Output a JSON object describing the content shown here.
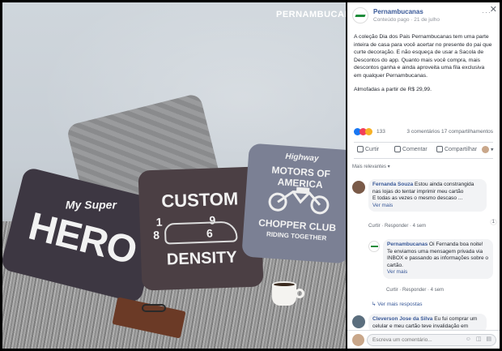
{
  "photo": {
    "watermark": "PERNAMBUCANAS",
    "pillows": {
      "hero_small": "My Super",
      "hero_big": "HERO",
      "custom_top": "CUSTOM",
      "custom_nums": "19 86",
      "custom_bottom": "DENSITY",
      "motor_top": "Highway",
      "motor_title": "MOTORS OF AMERICA",
      "motor_club": "CHOPPER CLUB",
      "motor_sub": "RIDING TOGETHER"
    }
  },
  "post": {
    "page_name": "Pernambucanas",
    "meta": "Conteúdo pago · 21 de julho",
    "options_icon": "···",
    "close_icon": "✕",
    "body": "A coleção Dia dos Pais Pernambucanas tem uma parte inteira de casa para você acertar no presente do pai que curte decoração. E não esqueça de usar a Sacola de Descontos do app. Quanto mais você compra, mais descontos ganha e ainda aproveita uma fila exclusiva em qualquer Pernambucanas.",
    "price": "Almofadas a partir de R$ 29,99.",
    "reaction_count": "133",
    "stats": "3 comentários  17 compartilhamentos",
    "actions": {
      "like": "Curtir",
      "comment": "Comentar",
      "share": "Compartilhar"
    }
  },
  "comments": {
    "sort_label": "Mais relevantes ▾",
    "c1": {
      "author": "Fernanda Souza",
      "text": " Estou ainda constrangida nas lojas do tentar imprimir meu cartão",
      "text2": "E todas as vezes o mesmo descaso ...",
      "see_more": "Ver mais",
      "actions": "Curtir · Responder · 4 sem",
      "react": "1"
    },
    "r1": {
      "author": "Pernambucanas",
      "text": " Oi Fernanda boa noite!",
      "text2": "Te enviamos uma mensagem privada via INBOX e passando as informações sobre o cartão.",
      "see_more": "Ver mais",
      "actions": "Curtir · Responder · 4 sem"
    },
    "more_replies": "↳ Ver mais respostas",
    "c2": {
      "author": "Cleverson Jose da Silva",
      "text": " Eu fui comprar um celular e meu cartão teve invalidação em"
    }
  },
  "composer": {
    "placeholder": "Escreva um comentário...",
    "icons": "☺ ◫ ▤"
  }
}
